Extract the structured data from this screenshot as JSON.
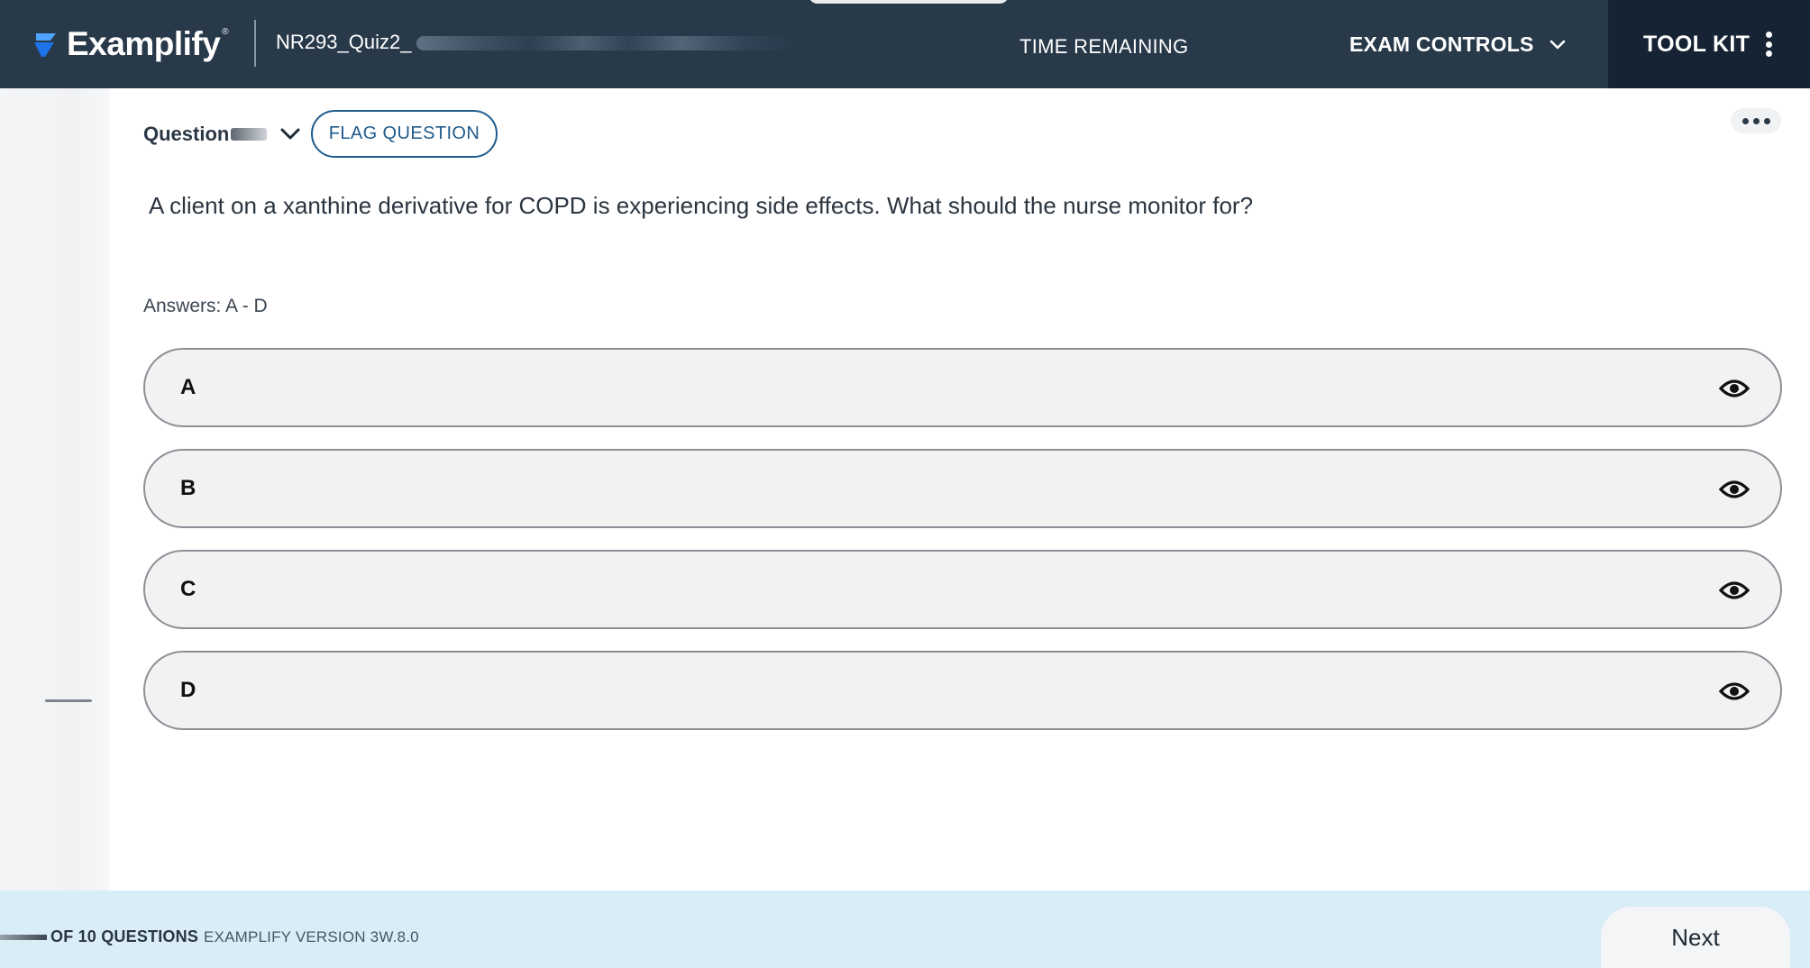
{
  "header": {
    "brand_name": "Examplify",
    "brand_mark": "®",
    "exam_name": "NR293_Quiz2_",
    "time_label": "TIME REMAINING",
    "exam_controls_label": "EXAM CONTROLS",
    "toolkit_label": "TOOL KIT"
  },
  "question": {
    "selector_label": "Question",
    "flag_label": "FLAG QUESTION",
    "text": "A client on a xanthine derivative for COPD is experiencing side effects. What should the nurse monitor for?",
    "answers_range": "Answers: A - D"
  },
  "options": [
    {
      "letter": "A",
      "text": ""
    },
    {
      "letter": "B",
      "text": ""
    },
    {
      "letter": "C",
      "text": ""
    },
    {
      "letter": "D",
      "text": ""
    }
  ],
  "footer": {
    "progress": "OF 10 QUESTIONS",
    "version": "EXAMPLIFY VERSION 3W.8.0",
    "next_label": "Next"
  },
  "colors": {
    "topbar": "#28394a",
    "toolkit_bg": "#152334",
    "accent": "#1f5b8c",
    "footer_bg": "#d9edf7"
  },
  "icons": {
    "brand": "examplify-logo-icon",
    "dropdown": "chevron-down-icon",
    "menu": "kebab-menu-icon",
    "more": "more-horizontal-icon",
    "option_action": "eye-icon"
  }
}
